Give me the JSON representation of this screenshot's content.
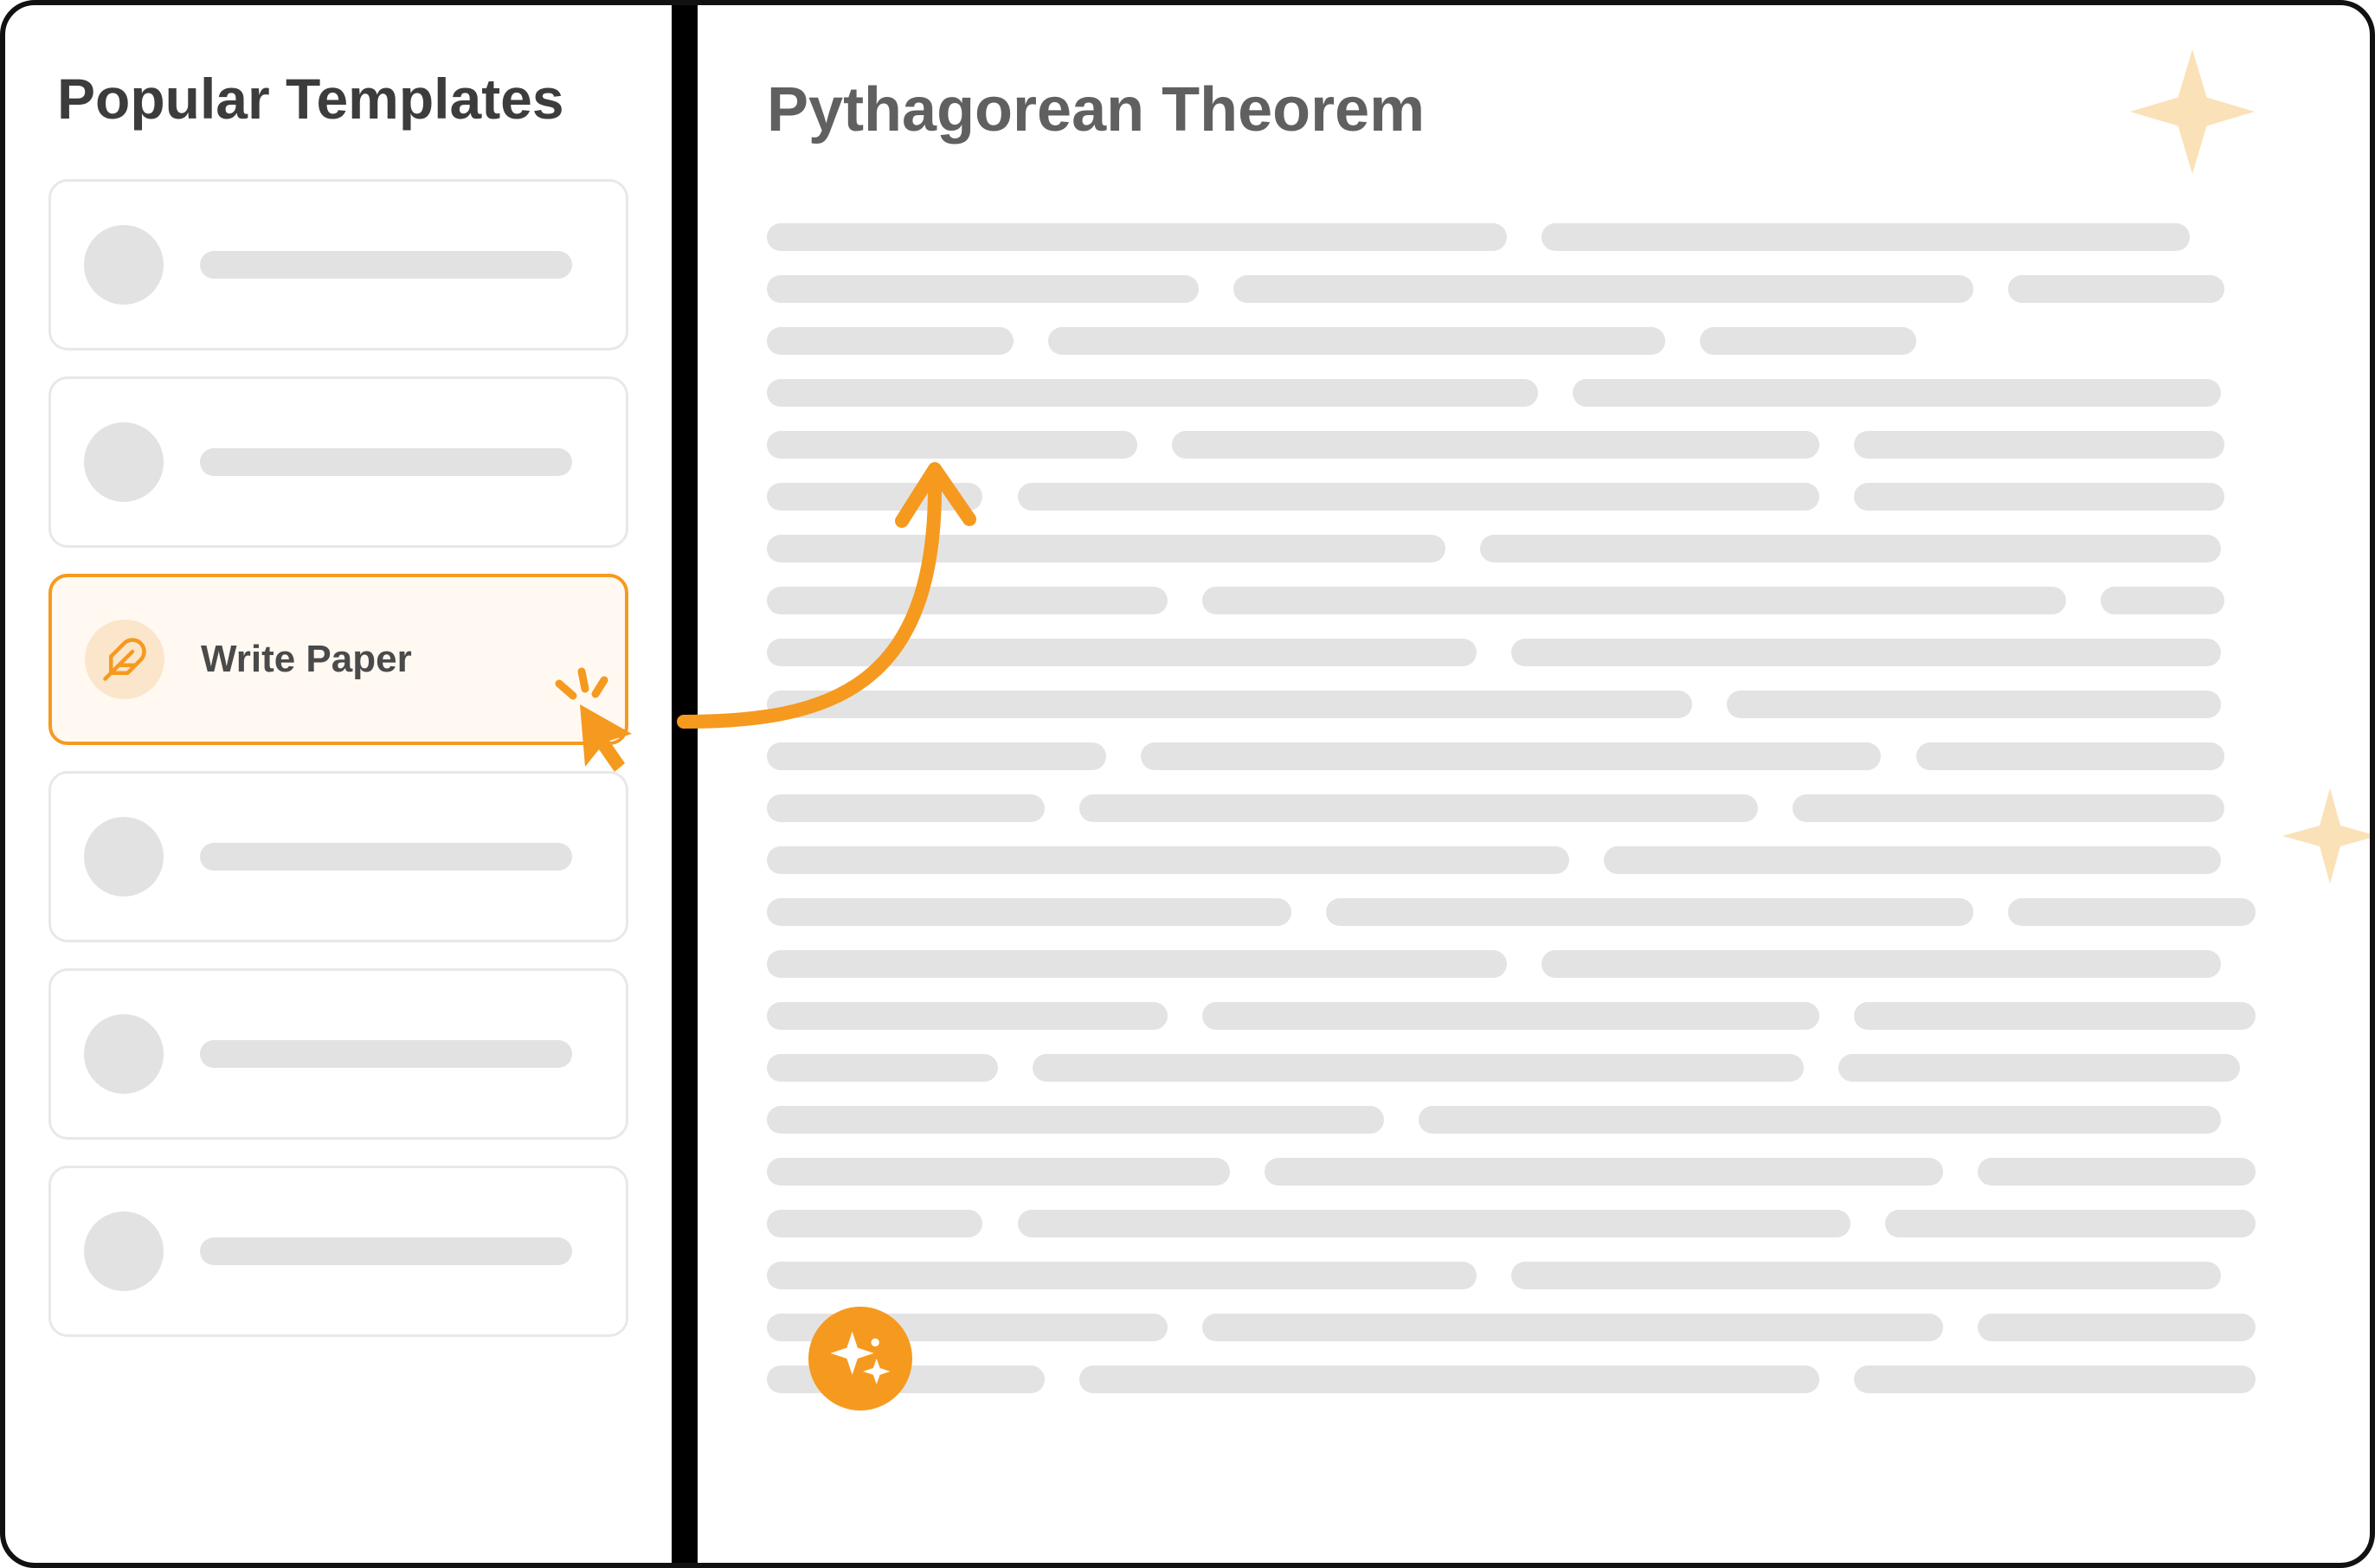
{
  "sidebar": {
    "title": "Popular Templates",
    "selected_index": 2,
    "items": [
      {
        "label": ""
      },
      {
        "label": ""
      },
      {
        "label": "Write Paper",
        "icon": "feather-icon"
      },
      {
        "label": ""
      },
      {
        "label": ""
      },
      {
        "label": ""
      }
    ]
  },
  "doc": {
    "title": "Pythagorean Theorem"
  },
  "colors": {
    "accent": "#f59a1f",
    "accent_soft": "#fbe6cc",
    "placeholder": "#e3e3e3",
    "text": "#3c3c3c"
  }
}
